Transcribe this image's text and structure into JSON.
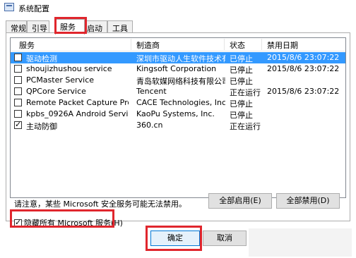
{
  "window": {
    "title": "系统配置"
  },
  "tabs": [
    {
      "label": "常规"
    },
    {
      "label": "引导"
    },
    {
      "label": "服务"
    },
    {
      "label": "启动"
    },
    {
      "label": "工具"
    }
  ],
  "columns": {
    "service": "服务",
    "manufacturer": "制造商",
    "status": "状态",
    "disabled_date": "禁用日期"
  },
  "rows": [
    {
      "checked": false,
      "service": "驱动检测",
      "manufacturer": "深圳市驱动人生软件技术有限...",
      "status": "已停止",
      "date": "2015/8/6 23:07:22",
      "selected": true
    },
    {
      "checked": false,
      "service": "shoujizhushou service",
      "manufacturer": "Kingsoft Corporation",
      "status": "已停止",
      "date": "2015/8/6 23:07:22",
      "selected": false
    },
    {
      "checked": false,
      "service": "PCMaster Service",
      "manufacturer": "青岛软媒网络科技有限公司",
      "status": "已停止",
      "date": "",
      "selected": false
    },
    {
      "checked": false,
      "service": "QPCore Service",
      "manufacturer": "Tencent",
      "status": "正在运行",
      "date": "2015/8/6 23:07:22",
      "selected": false
    },
    {
      "checked": false,
      "service": "Remote Packet Capture Protocol...",
      "manufacturer": "CACE Technologies, Inc.",
      "status": "已停止",
      "date": "",
      "selected": false
    },
    {
      "checked": false,
      "service": "kpbs_0926A Android Service",
      "manufacturer": "KaoPu Systems, Inc.",
      "status": "已停止",
      "date": "",
      "selected": false
    },
    {
      "checked": true,
      "service": "主动防御",
      "manufacturer": "360.cn",
      "status": "正在运行",
      "date": "",
      "selected": false
    }
  ],
  "note": "请注意，某些 Microsoft 安全服务可能无法禁用。",
  "buttons": {
    "enable_all": "全部启用(E)",
    "disable_all": "全部禁用(D)",
    "ok": "确定",
    "cancel": "取消"
  },
  "hide_ms": {
    "label": "隐藏所有 Microsoft 服务(H)",
    "checked": true
  }
}
